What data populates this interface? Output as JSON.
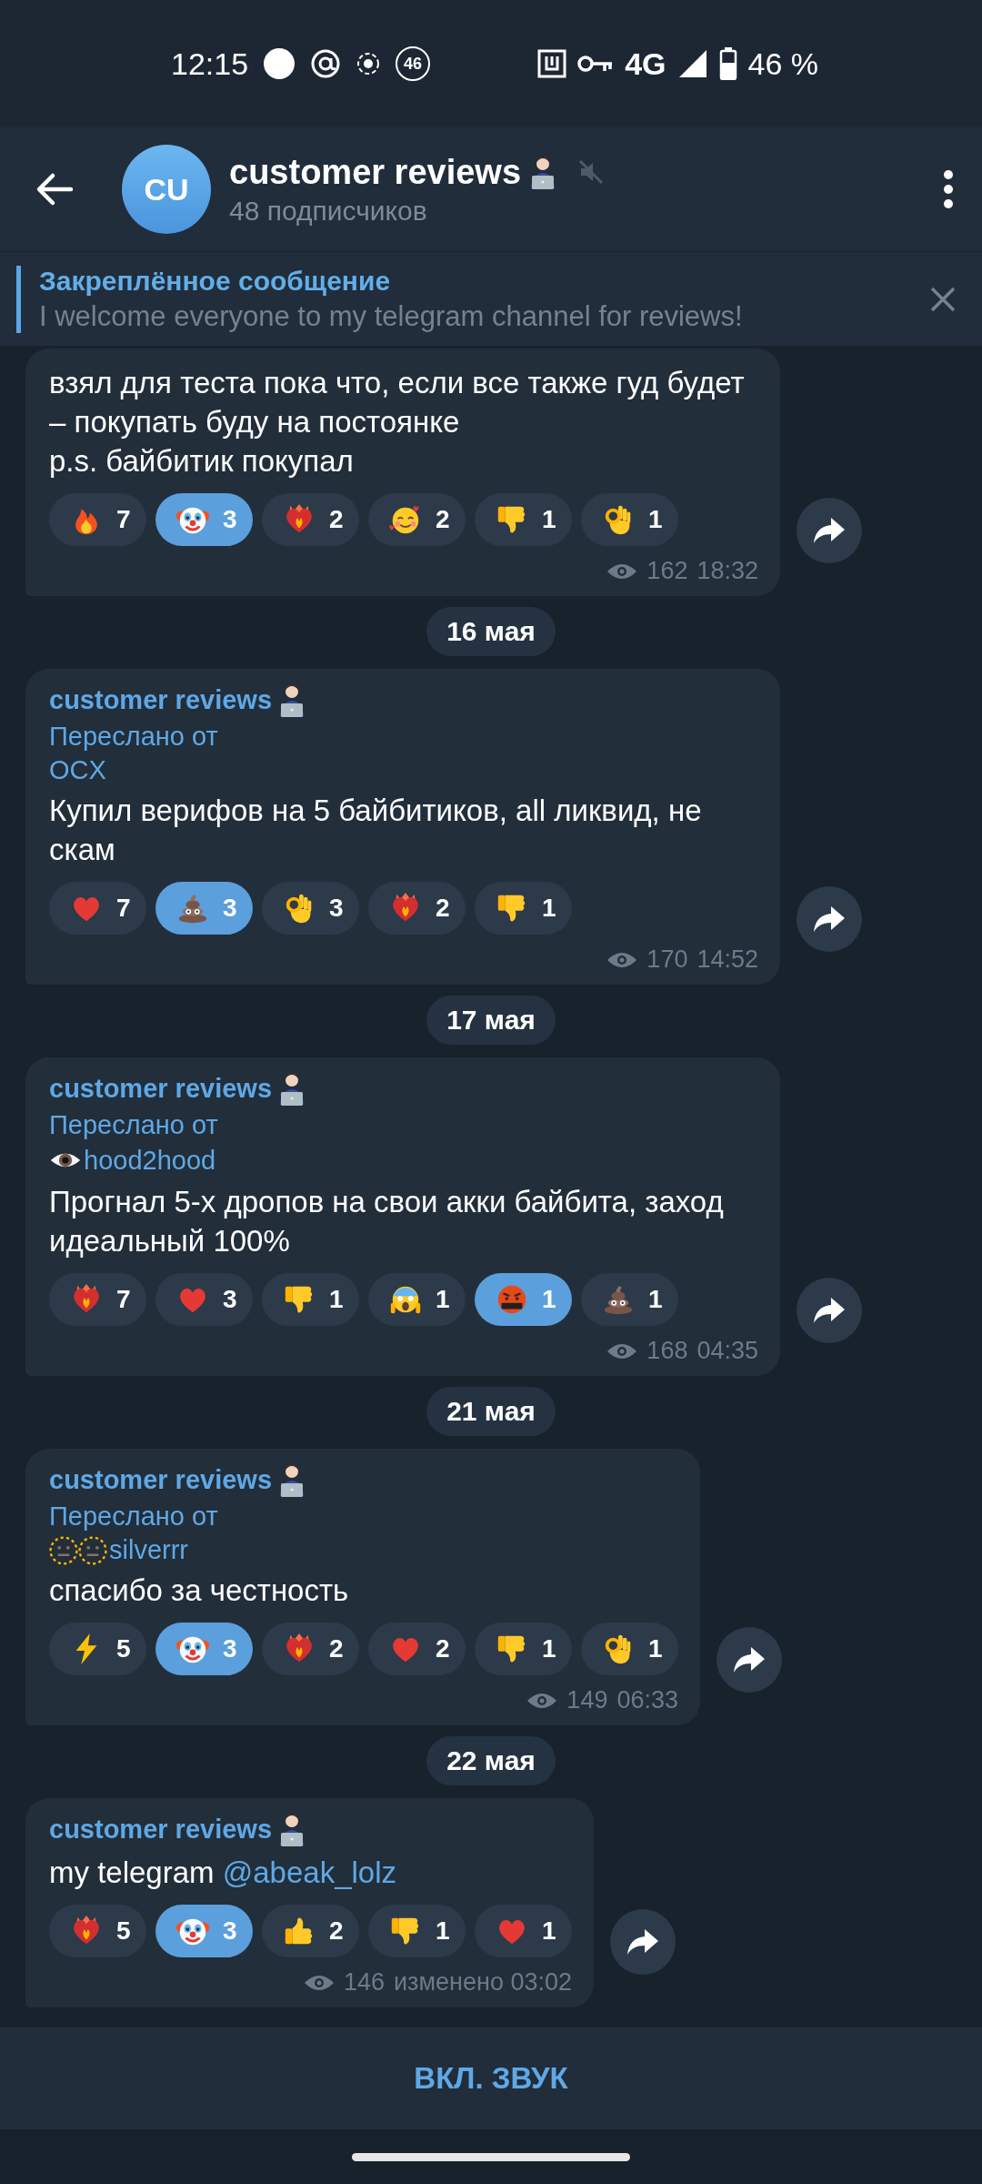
{
  "status_bar": {
    "time": "12:15",
    "badge": "46",
    "network": "4G",
    "battery": "46 %"
  },
  "header": {
    "avatar": "CU",
    "title": "customer reviews",
    "subtitle": "48 подписчиков",
    "muted": true
  },
  "pinned": {
    "title": "Закреплённое сообщение",
    "text": "I welcome everyone to my telegram channel for reviews!"
  },
  "feed": [
    {
      "kind": "message",
      "text": "взял для теста пока что, если все также гуд будет – покупать буду на постоянке\np.s. байбитик покупал",
      "reactions": [
        {
          "kind": "fire",
          "count": "7",
          "selected": false
        },
        {
          "kind": "clown",
          "count": "3",
          "selected": true
        },
        {
          "kind": "burning_heart",
          "count": "2",
          "selected": false
        },
        {
          "kind": "smiling_hearts",
          "count": "2",
          "selected": false
        },
        {
          "kind": "thumbs_down",
          "count": "1",
          "selected": false
        },
        {
          "kind": "ok_hand",
          "count": "1",
          "selected": false
        }
      ],
      "views": "162",
      "time": "18:32"
    },
    {
      "kind": "date",
      "text": "16 мая"
    },
    {
      "kind": "message",
      "author": "customer reviews",
      "forwarded": "Переслано от",
      "source": "OCX",
      "text": "Купил верифов на 5 байбитиков, all ликвид, не скам",
      "reactions": [
        {
          "kind": "heart",
          "count": "7",
          "selected": false
        },
        {
          "kind": "poop",
          "count": "3",
          "selected": true
        },
        {
          "kind": "ok_hand",
          "count": "3",
          "selected": false
        },
        {
          "kind": "burning_heart",
          "count": "2",
          "selected": false
        },
        {
          "kind": "thumbs_down",
          "count": "1",
          "selected": false
        }
      ],
      "views": "170",
      "time": "14:52"
    },
    {
      "kind": "date",
      "text": "17 мая"
    },
    {
      "kind": "message",
      "author": "customer reviews",
      "forwarded": "Переслано от",
      "source": "hood2hood",
      "source_emoji": {
        "kind": "eye"
      },
      "text": "Прогнал 5-х дропов на свои акки байбита, заход идеальный 100%",
      "reactions": [
        {
          "kind": "burning_heart",
          "count": "7",
          "selected": false
        },
        {
          "kind": "heart",
          "count": "3",
          "selected": false
        },
        {
          "kind": "thumbs_down",
          "count": "1",
          "selected": false
        },
        {
          "kind": "scream",
          "count": "1",
          "selected": false
        },
        {
          "kind": "cursing",
          "count": "1",
          "selected": true
        },
        {
          "kind": "poop",
          "count": "1",
          "selected": false
        }
      ],
      "views": "168",
      "time": "04:35"
    },
    {
      "kind": "date",
      "text": "21 мая"
    },
    {
      "kind": "message",
      "author": "customer reviews",
      "forwarded": "Переслано от",
      "source": "silverrr",
      "source_emoji": {
        "kind": "dotted_faces"
      },
      "text": "спасибо за честность",
      "reactions": [
        {
          "kind": "lightning",
          "count": "5",
          "selected": false
        },
        {
          "kind": "clown",
          "count": "3",
          "selected": true
        },
        {
          "kind": "burning_heart",
          "count": "2",
          "selected": false
        },
        {
          "kind": "heart",
          "count": "2",
          "selected": false
        },
        {
          "kind": "thumbs_down",
          "count": "1",
          "selected": false
        },
        {
          "kind": "ok_hand",
          "count": "1",
          "selected": false
        }
      ],
      "views": "149",
      "time": "06:33"
    },
    {
      "kind": "date",
      "text": "22 мая"
    },
    {
      "kind": "message",
      "author": "customer reviews",
      "text": "my telegram ",
      "link": "@abeak_lolz",
      "reactions": [
        {
          "kind": "burning_heart",
          "count": "5",
          "selected": false
        },
        {
          "kind": "clown",
          "count": "3",
          "selected": true
        },
        {
          "kind": "thumbs_up",
          "count": "2",
          "selected": false
        },
        {
          "kind": "thumbs_down",
          "count": "1",
          "selected": false
        },
        {
          "kind": "heart",
          "count": "1",
          "selected": false
        }
      ],
      "views": "146",
      "time": "изменено 03:02"
    }
  ],
  "bottom_bar": {
    "button": "ВКЛ. ЗВУК"
  }
}
